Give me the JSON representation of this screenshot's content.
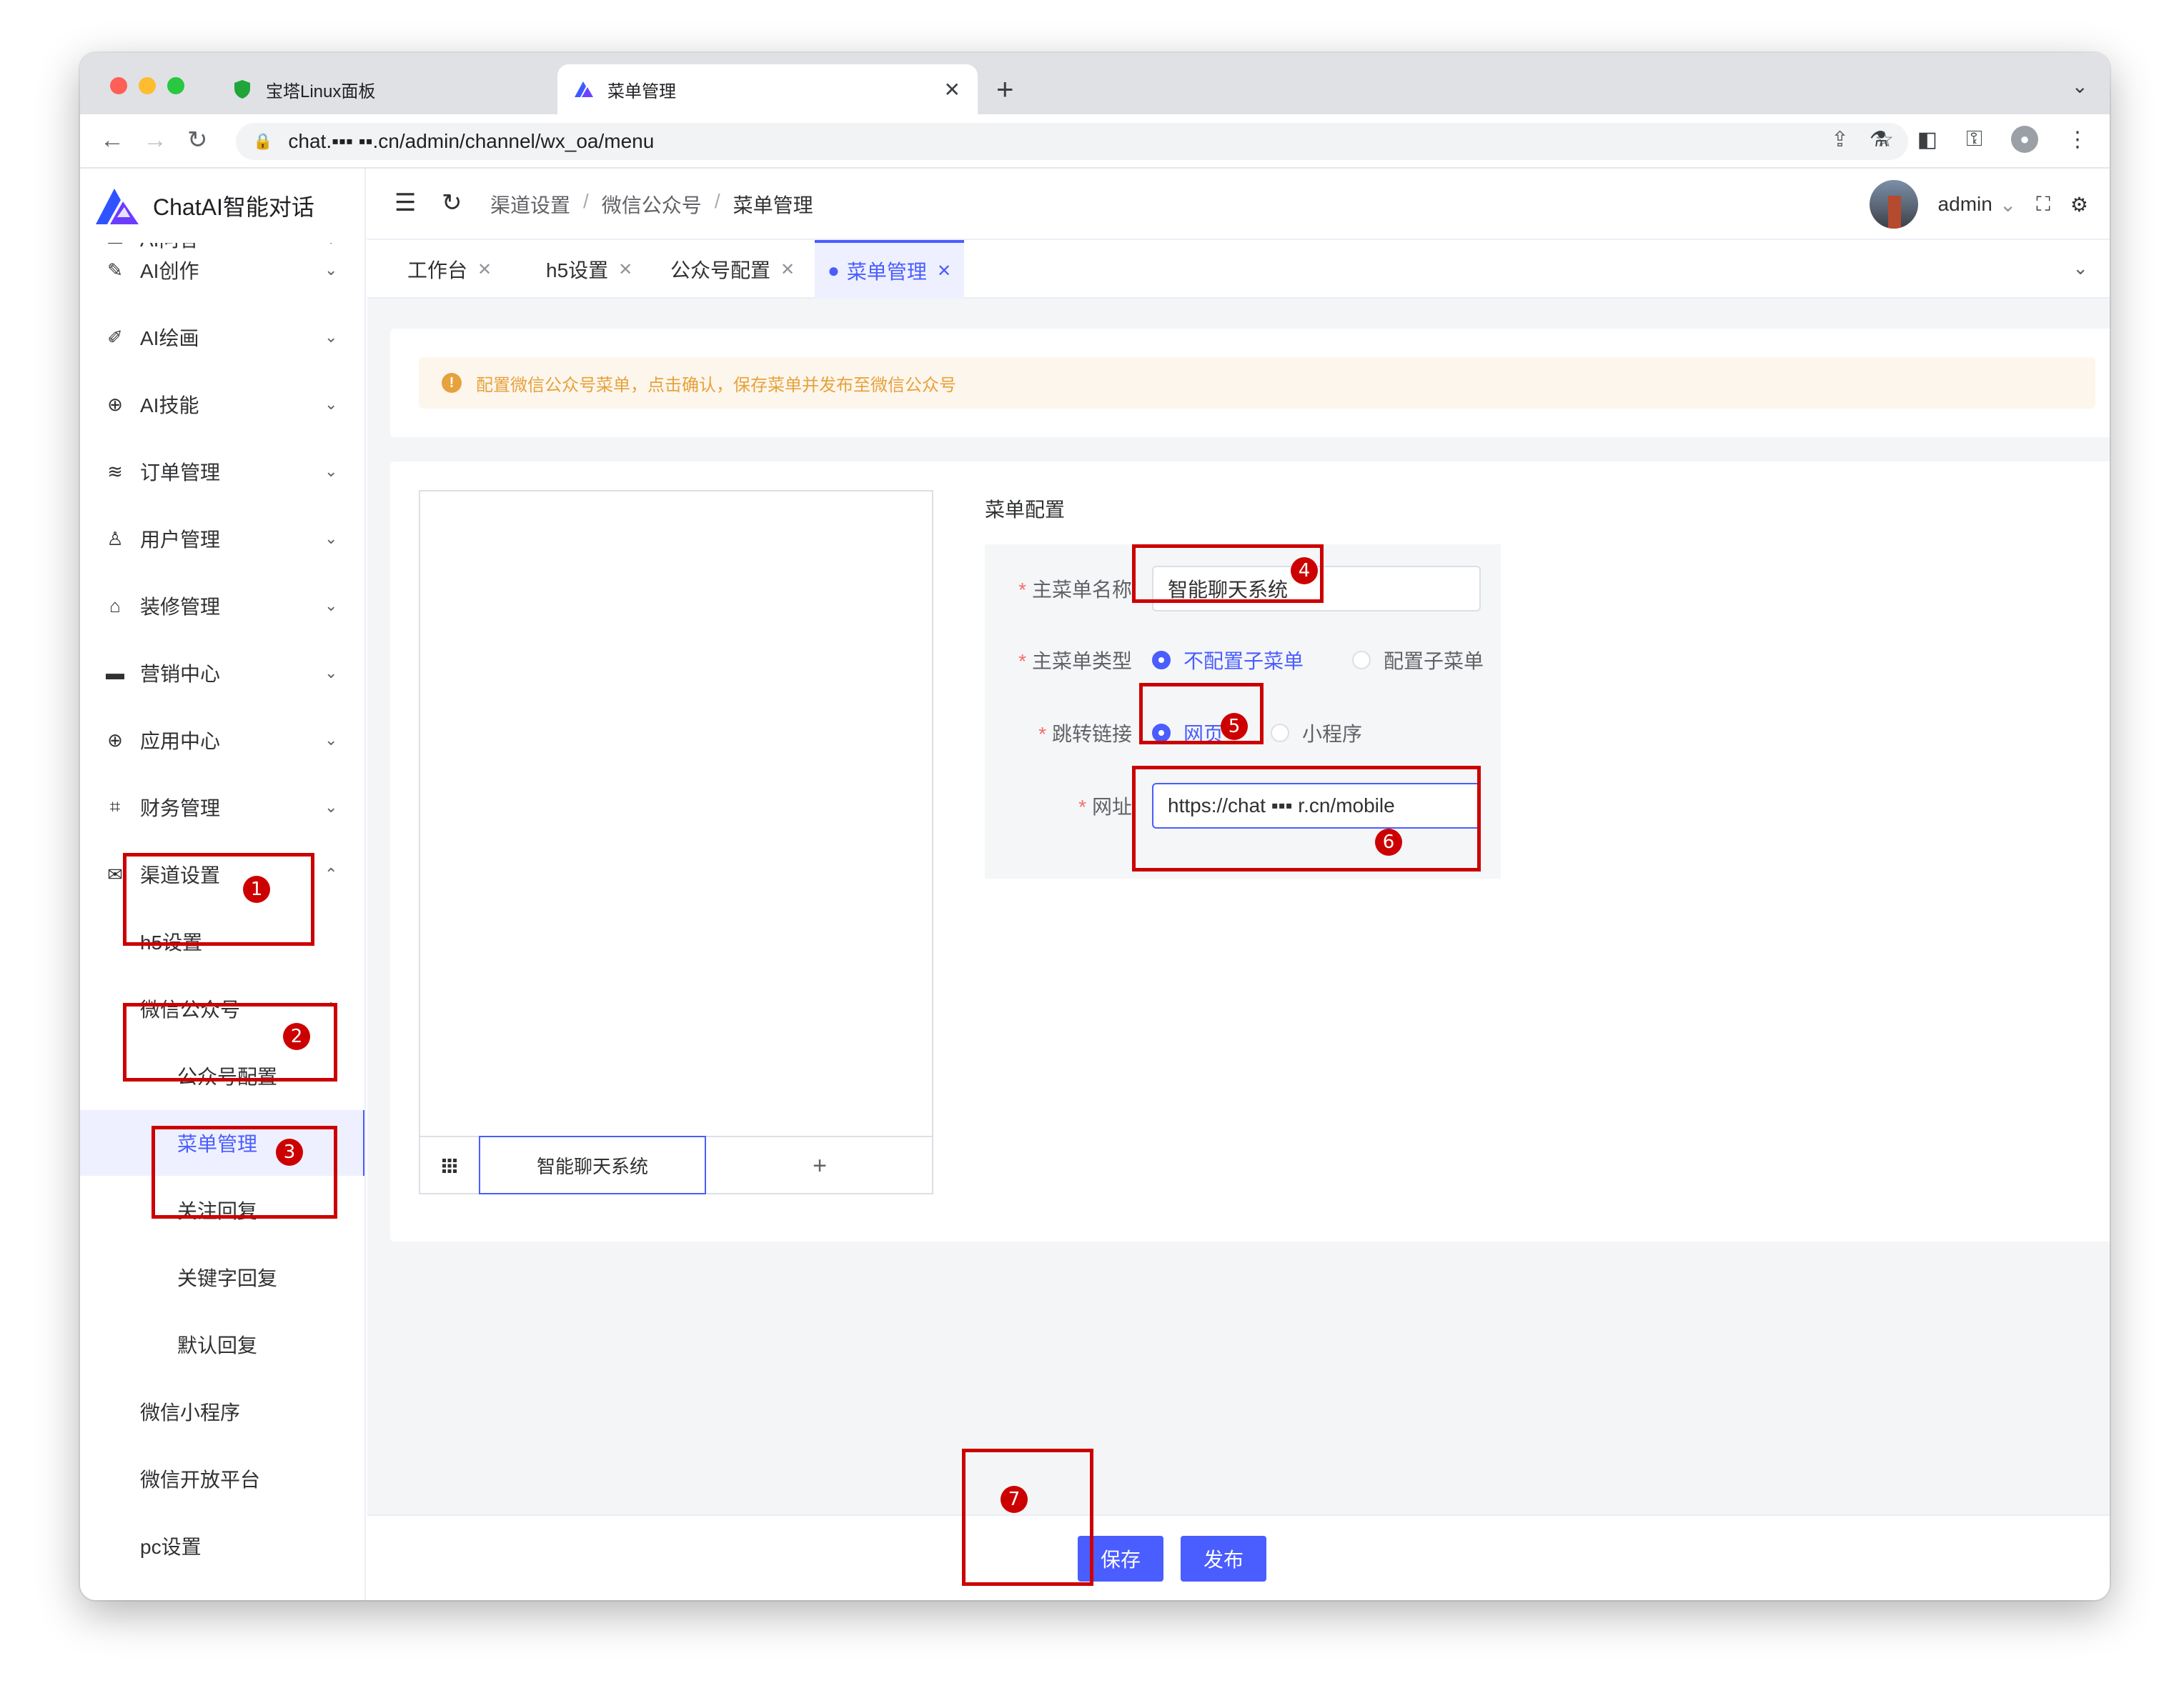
{
  "browser": {
    "tabs": [
      {
        "label": "宝塔Linux面板",
        "active": false,
        "icon": "shield-icon"
      },
      {
        "label": "菜单管理",
        "active": true,
        "icon": "chatai-logo-icon"
      }
    ],
    "url": "chat.▪▪▪ ▪▪.cn/admin/channel/wx_oa/menu"
  },
  "app": {
    "brand_name": "ChatAI智能对话",
    "colors": {
      "primary": "#4a5dff",
      "warning": "#e6a23c",
      "required": "#f56c6c",
      "annotation": "#cc0000"
    }
  },
  "sidebar": {
    "items": [
      {
        "label": "AI问答",
        "icon": "chat-icon",
        "chevron": "down"
      },
      {
        "label": "AI创作",
        "icon": "pen-icon",
        "chevron": "down"
      },
      {
        "label": "AI绘画",
        "icon": "brush-icon",
        "chevron": "down"
      },
      {
        "label": "AI技能",
        "icon": "skill-icon",
        "chevron": "down"
      },
      {
        "label": "订单管理",
        "icon": "database-icon",
        "chevron": "down"
      },
      {
        "label": "用户管理",
        "icon": "user-icon",
        "chevron": "down"
      },
      {
        "label": "装修管理",
        "icon": "decor-icon",
        "chevron": "down"
      },
      {
        "label": "营销中心",
        "icon": "briefcase-icon",
        "chevron": "down"
      },
      {
        "label": "应用中心",
        "icon": "apps-icon",
        "chevron": "down"
      },
      {
        "label": "财务管理",
        "icon": "chart-icon",
        "chevron": "down"
      },
      {
        "label": "渠道设置",
        "icon": "mail-icon",
        "chevron": "up"
      },
      {
        "label": "h5设置",
        "level": 1
      },
      {
        "label": "微信公众号",
        "level": 1,
        "chevron": "up"
      },
      {
        "label": "公众号配置",
        "level": 2
      },
      {
        "label": "菜单管理",
        "level": 2,
        "active": true
      },
      {
        "label": "关注回复",
        "level": 2
      },
      {
        "label": "关键字回复",
        "level": 2
      },
      {
        "label": "默认回复",
        "level": 2
      },
      {
        "label": "微信小程序",
        "level": 1
      },
      {
        "label": "微信开放平台",
        "level": 1
      },
      {
        "label": "pc设置",
        "level": 1
      }
    ]
  },
  "header": {
    "breadcrumb": [
      "渠道设置",
      "微信公众号",
      "菜单管理"
    ],
    "username": "admin"
  },
  "tags": [
    {
      "label": "工作台",
      "active": false
    },
    {
      "label": "h5设置",
      "active": false
    },
    {
      "label": "公众号配置",
      "active": false
    },
    {
      "label": "菜单管理",
      "active": true
    }
  ],
  "alert": {
    "text": "配置微信公众号菜单，点击确认，保存菜单并发布至微信公众号"
  },
  "preview": {
    "menu_item": "智能聊天系统",
    "add_symbol": "+"
  },
  "config": {
    "title": "菜单配置",
    "main_menu_name": {
      "label": "主菜单名称",
      "value": "智能聊天系统"
    },
    "main_menu_type": {
      "label": "主菜单类型",
      "options": [
        "不配置子菜单",
        "配置子菜单"
      ],
      "selected": "不配置子菜单"
    },
    "jump_link": {
      "label": "跳转链接",
      "options": [
        "网页",
        "小程序"
      ],
      "selected": "网页"
    },
    "url": {
      "label": "网址",
      "value": "https://chat ▪▪▪ r.cn/mobile"
    }
  },
  "footer": {
    "save_label": "保存",
    "publish_label": "发布"
  },
  "annotations": [
    "1",
    "2",
    "3",
    "4",
    "5",
    "6",
    "7"
  ]
}
